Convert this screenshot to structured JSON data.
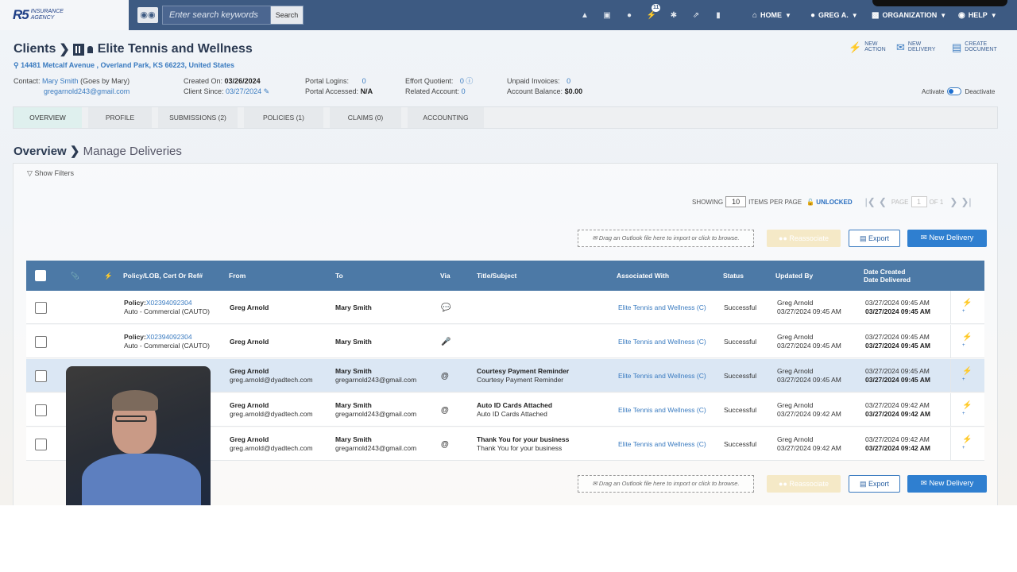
{
  "logo": {
    "mark": "R5",
    "sub_line1": "INSURANCE",
    "sub_line2": "AGENCY"
  },
  "topbar": {
    "search_placeholder": "Enter search keywords",
    "search_button": "Search",
    "notification_count": "11",
    "nav": {
      "home": "HOME",
      "user": "GREG A.",
      "organization": "ORGANIZATION",
      "help": "HELP"
    }
  },
  "client": {
    "breadcrumb": "Clients",
    "name": "Elite Tennis and Wellness",
    "address": "14481 Metcalf Avenue , Overland Park, KS 66223, United States",
    "contact_label": "Contact:",
    "contact_name": "Mary Smith",
    "contact_note": "(Goes by Mary)",
    "contact_email": "gregarnold243@gmail.com",
    "created_label": "Created On:",
    "created_value": "03/26/2024",
    "since_label": "Client Since:",
    "since_value": "03/27/2024",
    "portal_logins_label": "Portal Logins:",
    "portal_logins_value": "0",
    "portal_accessed_label": "Portal Accessed:",
    "portal_accessed_value": "N/A",
    "effort_label": "Effort Quotient:",
    "effort_value": "0",
    "related_label": "Related Account:",
    "related_value": "0",
    "unpaid_label": "Unpaid Invoices:",
    "unpaid_value": "0",
    "balance_label": "Account Balance:",
    "balance_value": "$0.00"
  },
  "actions": {
    "new_action_1": "NEW",
    "new_action_2": "ACTION",
    "new_delivery_1": "NEW",
    "new_delivery_2": "DELIVERY",
    "create_document_1": "CREATE",
    "create_document_2": "DOCUMENT",
    "activate": "Activate",
    "deactivate": "Deactivate"
  },
  "tabs": [
    "OVERVIEW",
    "PROFILE",
    "SUBMISSIONS (2)",
    "POLICIES (1)",
    "CLAIMS (0)",
    "ACCOUNTING"
  ],
  "overview": {
    "title": "Overview",
    "subtitle": "Manage Deliveries",
    "show_filters": "Show Filters"
  },
  "pager": {
    "showing": "SHOWING",
    "per_page_value": "10",
    "items_per_page": "ITEMS PER PAGE",
    "unlocked": "UNLOCKED",
    "page_label": "PAGE",
    "page_value": "1",
    "of_label": "OF 1"
  },
  "toolbar": {
    "dropzone": "Drag an Outlook file here to import or click to browse.",
    "reassociate": "Reassociate",
    "export": "Export",
    "new_delivery": "New Delivery"
  },
  "table": {
    "headers": {
      "policy": "Policy/LOB, Cert Or Ref#",
      "from": "From",
      "to": "To",
      "via": "Via",
      "title": "Title/Subject",
      "associated": "Associated With",
      "status": "Status",
      "updated": "Updated By",
      "date_created": "Date Created",
      "date_delivered": "Date Delivered"
    },
    "rows": [
      {
        "policy_label": "Policy:",
        "policy_no": "X02394092304",
        "lob": "Auto - Commercial (CAUTO)",
        "from_name": "Greg Arnold",
        "from_email": "",
        "to_name": "Mary Smith",
        "to_email": "",
        "via": "💬",
        "title1": "",
        "title2": "",
        "assoc": "Elite Tennis and Wellness (C)",
        "status": "Successful",
        "upd_name": "Greg Arnold",
        "upd_date": "03/27/2024 09:45 AM",
        "created": "03/27/2024 09:45 AM",
        "delivered": "03/27/2024 09:45 AM"
      },
      {
        "policy_label": "Policy:",
        "policy_no": "X02394092304",
        "lob": "Auto - Commercial (CAUTO)",
        "from_name": "Greg Arnold",
        "from_email": "",
        "to_name": "Mary Smith",
        "to_email": "",
        "via": "🎤",
        "title1": "",
        "title2": "",
        "assoc": "Elite Tennis and Wellness (C)",
        "status": "Successful",
        "upd_name": "Greg Arnold",
        "upd_date": "03/27/2024 09:45 AM",
        "created": "03/27/2024 09:45 AM",
        "delivered": "03/27/2024 09:45 AM"
      },
      {
        "policy_label": "",
        "policy_no": "",
        "lob": "O)",
        "from_name": "Greg Arnold",
        "from_email": "greg.arnold@dyadtech.com",
        "to_name": "Mary Smith",
        "to_email": "gregarnold243@gmail.com",
        "via": "@",
        "title1": "Courtesy Payment Reminder",
        "title2": "Courtesy Payment Reminder",
        "assoc": "Elite Tennis and Wellness (C)",
        "status": "Successful",
        "upd_name": "Greg Arnold",
        "upd_date": "03/27/2024 09:45 AM",
        "created": "03/27/2024 09:45 AM",
        "delivered": "03/27/2024 09:45 AM"
      },
      {
        "policy_label": "",
        "policy_no": "",
        "lob": "O)",
        "from_name": "Greg Arnold",
        "from_email": "greg.arnold@dyadtech.com",
        "to_name": "Mary Smith",
        "to_email": "gregarnold243@gmail.com",
        "via": "@",
        "title1": "Auto ID Cards Attached",
        "title2": "Auto ID Cards Attached",
        "assoc": "Elite Tennis and Wellness (C)",
        "status": "Successful",
        "upd_name": "Greg Arnold",
        "upd_date": "03/27/2024 09:42 AM",
        "created": "03/27/2024 09:42 AM",
        "delivered": "03/27/2024 09:42 AM"
      },
      {
        "policy_label": "",
        "policy_no": "",
        "lob": "O)",
        "from_name": "Greg Arnold",
        "from_email": "greg.arnold@dyadtech.com",
        "to_name": "Mary Smith",
        "to_email": "gregarnold243@gmail.com",
        "via": "@",
        "title1": "Thank You for your business",
        "title2": "Thank You for your business",
        "assoc": "Elite Tennis and Wellness (C)",
        "status": "Successful",
        "upd_name": "Greg Arnold",
        "upd_date": "03/27/2024 09:42 AM",
        "created": "03/27/2024 09:42 AM",
        "delivered": "03/27/2024 09:42 AM"
      }
    ]
  }
}
